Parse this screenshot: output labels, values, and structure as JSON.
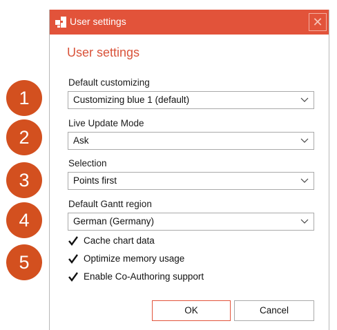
{
  "window": {
    "title": "User settings",
    "app_icon": "puzzle-icon",
    "close_icon": "close-icon",
    "close_glyph": "✕"
  },
  "heading": "User settings",
  "fields": [
    {
      "label": "Default customizing",
      "value": "Customizing blue 1 (default)"
    },
    {
      "label": "Live Update Mode",
      "value": "Ask"
    },
    {
      "label": "Selection",
      "value": "Points first"
    },
    {
      "label": "Default Gantt region",
      "value": "German (Germany)"
    }
  ],
  "checkboxes": [
    {
      "label": "Cache chart data",
      "checked": true
    },
    {
      "label": "Optimize memory usage",
      "checked": true
    },
    {
      "label": "Enable Co-Authoring support",
      "checked": true
    }
  ],
  "buttons": {
    "ok": "OK",
    "cancel": "Cancel"
  },
  "steps": [
    "1",
    "2",
    "3",
    "4",
    "5"
  ],
  "colors": {
    "accent": "#e2533a",
    "step_badge": "#d3501f",
    "heading": "#d9533a"
  }
}
